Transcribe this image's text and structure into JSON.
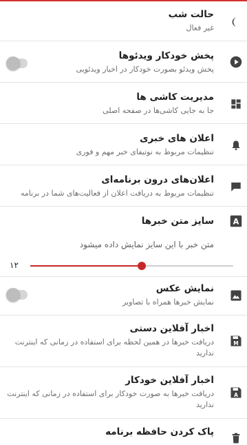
{
  "accent": "#c62828",
  "icon_color": "#424242",
  "items": [
    {
      "title": "حالت شب",
      "subtitle": "غیر فعال",
      "icon": "moon-icon"
    },
    {
      "title": "پخش خودکار ویدئوها",
      "subtitle": "پخش ویدئو بصورت خودکار در اخبار ویدئویی",
      "icon": "play-circle-icon",
      "toggle": false
    },
    {
      "title": "مدیریت کاشی ها",
      "subtitle": "جا به جایی کاشی‌ها در صفحه اصلی",
      "icon": "dashboard-icon"
    },
    {
      "title": "اعلان های خبری",
      "subtitle": "تنظیمات مربوط به نوتیفای خبر مهم و فوری",
      "icon": "bell-icon"
    },
    {
      "title": "اعلان‌های درون برنامه‌ای",
      "subtitle": "تنظیمات مربوط به دریافت اعلان از فعالیت‌های شما در برنامه",
      "icon": "flag-icon"
    },
    {
      "title": "سایز متن خبرها",
      "icon": "font-size-icon"
    },
    {
      "title": "نمایش عکس",
      "subtitle": "نمایش خبرها همراه با تصاویر",
      "icon": "image-icon",
      "toggle": false
    },
    {
      "title": "اخبار آفلاین دستی",
      "subtitle": "دریافت خبرها در همین لحظه برای استفاده در زمانی که اینترنت ندارید",
      "icon": "save-m-icon"
    },
    {
      "title": "اخبار آفلاین خودکار",
      "subtitle": "دریافت خبرها به صورت خودکار برای استفاده در زمانی که اینترنت ندارید",
      "icon": "save-a-icon"
    },
    {
      "title": "پاک کردن حافظه برنامه",
      "icon": "trash-icon"
    }
  ],
  "font_size": {
    "preview_text": "متن خبر با این سایز نمایش داده میشود",
    "value_label": "۱۲",
    "level": 0.55
  }
}
